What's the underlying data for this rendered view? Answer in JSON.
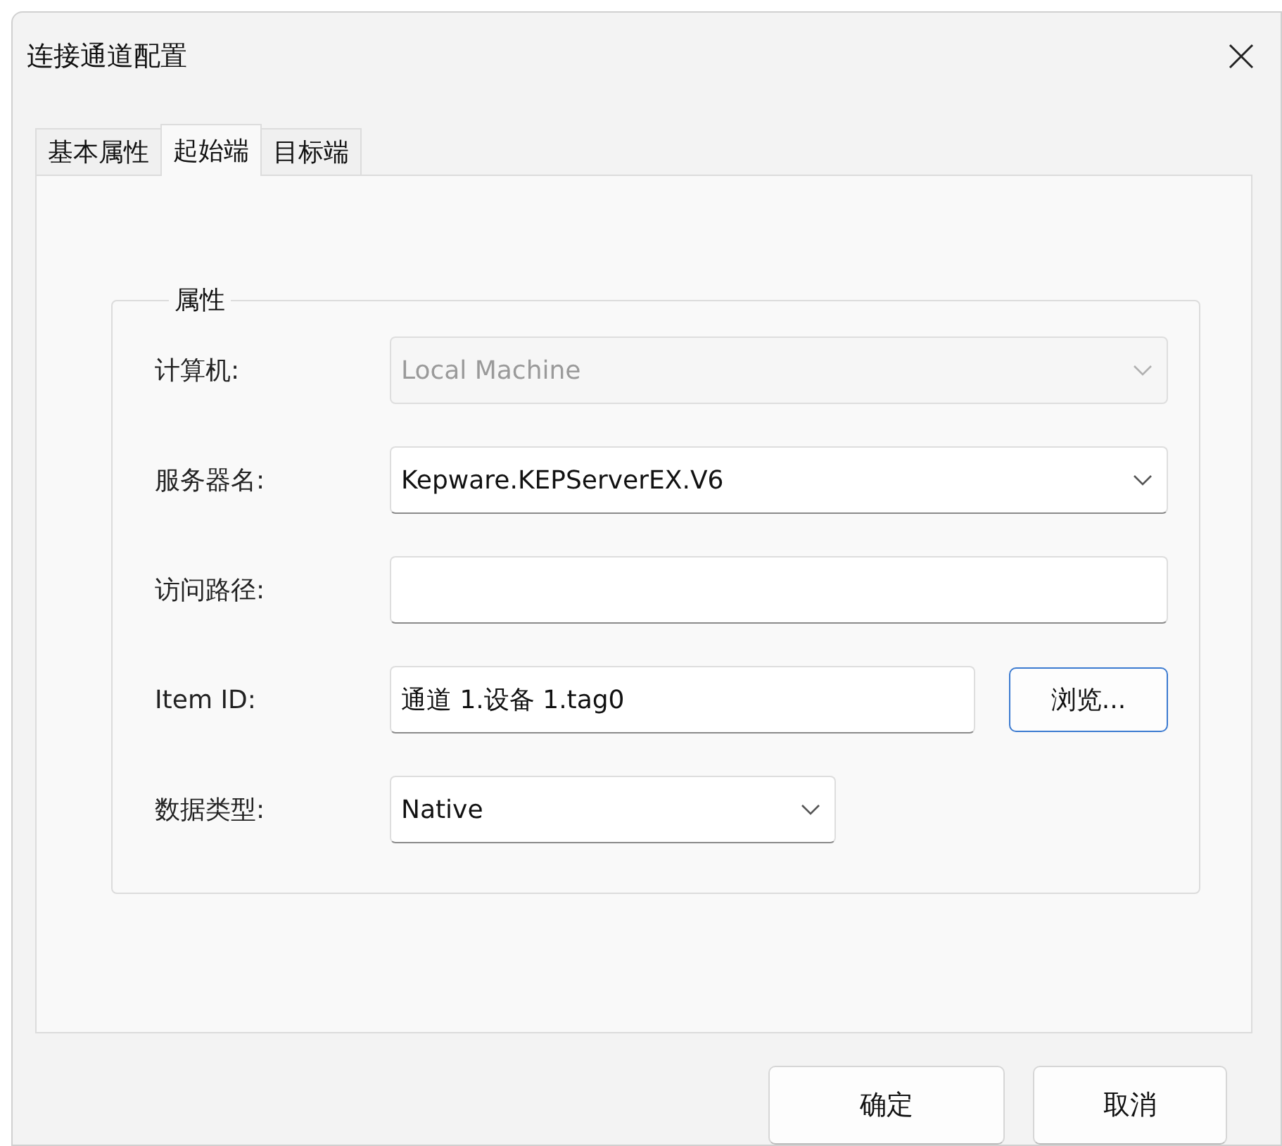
{
  "window": {
    "title": "连接通道配置"
  },
  "tabs": [
    {
      "label": "基本属性",
      "selected": false
    },
    {
      "label": "起始端",
      "selected": true
    },
    {
      "label": "目标端",
      "selected": false
    }
  ],
  "group": {
    "title": "属性",
    "fields": [
      {
        "label": "计算机:",
        "kind": "combo",
        "value": "Local Machine",
        "disabled": true
      },
      {
        "label": "服务器名:",
        "kind": "combo",
        "value": "Kepware.KEPServerEX.V6",
        "disabled": false
      },
      {
        "label": "访问路径:",
        "kind": "text"
      },
      {
        "label": "Item ID:",
        "kind": "browse",
        "value": "通道 1.设备 1.tag0",
        "button": "浏览..."
      },
      {
        "label": "数据类型:",
        "kind": "select",
        "value": "Native",
        "disabled": false
      }
    ]
  },
  "buttons": [
    "确定",
    "取消"
  ]
}
